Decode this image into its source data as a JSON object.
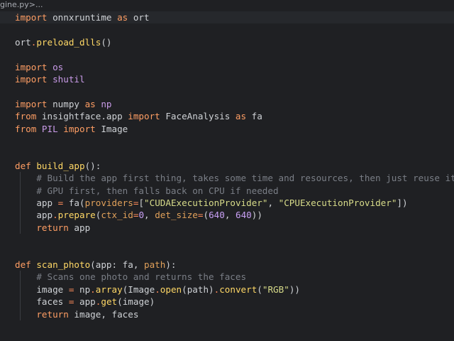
{
  "breadcrumb": {
    "file": "gine.py",
    "separator": " > ",
    "more": "..."
  },
  "code_lines": [
    [
      [
        "kw",
        "import"
      ],
      [
        "ident",
        " onnxruntime "
      ],
      [
        "kw",
        "as"
      ],
      [
        "ident",
        " ort"
      ]
    ],
    [],
    [
      [
        "ident",
        "ort"
      ],
      [
        "op",
        "."
      ],
      [
        "fn",
        "preload_dlls"
      ],
      [
        "ident",
        "()"
      ]
    ],
    [],
    [
      [
        "kw",
        "import"
      ],
      [
        "mod",
        " os"
      ]
    ],
    [
      [
        "kw",
        "import"
      ],
      [
        "mod",
        " shutil"
      ]
    ],
    [],
    [
      [
        "kw",
        "import"
      ],
      [
        "ident",
        " numpy "
      ],
      [
        "kw",
        "as"
      ],
      [
        "mod",
        " np"
      ]
    ],
    [
      [
        "kw",
        "from"
      ],
      [
        "ident",
        " insightface.app "
      ],
      [
        "kw",
        "import"
      ],
      [
        "ident",
        " FaceAnalysis "
      ],
      [
        "kw",
        "as"
      ],
      [
        "ident",
        " fa"
      ]
    ],
    [
      [
        "kw",
        "from"
      ],
      [
        "mod",
        " PIL "
      ],
      [
        "kw",
        "import"
      ],
      [
        "ident",
        " Image"
      ]
    ],
    [],
    [],
    [
      [
        "kw",
        "def"
      ],
      [
        "fn",
        " build_app"
      ],
      [
        "ident",
        "():"
      ]
    ],
    [
      [
        "cm",
        "    # Build the app first thing, takes some time and resources, then just reuse it"
      ]
    ],
    [
      [
        "cm",
        "    # GPU first, then falls back on CPU if needed"
      ]
    ],
    [
      [
        "ident",
        "    app "
      ],
      [
        "op",
        "="
      ],
      [
        "ident",
        " fa("
      ],
      [
        "param",
        "providers"
      ],
      [
        "op",
        "="
      ],
      [
        "ident",
        "["
      ],
      [
        "str",
        "\"CUDAExecutionProvider\""
      ],
      [
        "ident",
        ", "
      ],
      [
        "str",
        "\"CPUExecutionProvider\""
      ],
      [
        "ident",
        "])"
      ]
    ],
    [
      [
        "ident",
        "    app"
      ],
      [
        "op",
        "."
      ],
      [
        "fn",
        "prepare"
      ],
      [
        "ident",
        "("
      ],
      [
        "param",
        "ctx_id"
      ],
      [
        "op",
        "="
      ],
      [
        "num",
        "0"
      ],
      [
        "ident",
        ", "
      ],
      [
        "param",
        "det_size"
      ],
      [
        "op",
        "="
      ],
      [
        "ident",
        "("
      ],
      [
        "num",
        "640"
      ],
      [
        "ident",
        ", "
      ],
      [
        "num",
        "640"
      ],
      [
        "ident",
        "))"
      ]
    ],
    [
      [
        "kw",
        "    return"
      ],
      [
        "ident",
        " app"
      ]
    ],
    [],
    [],
    [
      [
        "kw",
        "def"
      ],
      [
        "fn",
        " scan_photo"
      ],
      [
        "ident",
        "(app: fa, "
      ],
      [
        "param",
        "path"
      ],
      [
        "ident",
        "):"
      ]
    ],
    [
      [
        "cm",
        "    # Scans one photo and returns the faces"
      ]
    ],
    [
      [
        "ident",
        "    image "
      ],
      [
        "op",
        "="
      ],
      [
        "ident",
        " np"
      ],
      [
        "op",
        "."
      ],
      [
        "fn",
        "array"
      ],
      [
        "ident",
        "(Image"
      ],
      [
        "op",
        "."
      ],
      [
        "fn",
        "open"
      ],
      [
        "ident",
        "(path)"
      ],
      [
        "op",
        "."
      ],
      [
        "fn",
        "convert"
      ],
      [
        "ident",
        "("
      ],
      [
        "str",
        "\"RGB\""
      ],
      [
        "ident",
        "))"
      ]
    ],
    [
      [
        "ident",
        "    faces "
      ],
      [
        "op",
        "="
      ],
      [
        "ident",
        " app"
      ],
      [
        "op",
        "."
      ],
      [
        "fn",
        "get"
      ],
      [
        "ident",
        "(image)"
      ]
    ],
    [
      [
        "kw",
        "    return"
      ],
      [
        "ident",
        " image, faces"
      ]
    ]
  ],
  "current_line": 0
}
